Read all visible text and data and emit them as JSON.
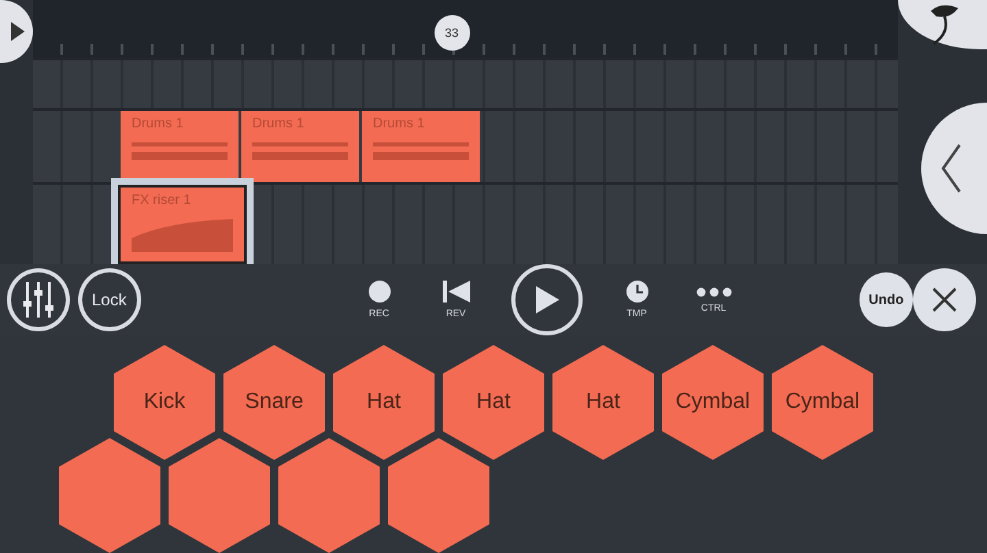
{
  "marker": "33",
  "drum_clips": [
    {
      "name": "Drums 1",
      "selected": false
    },
    {
      "name": "Drums 1",
      "selected": false
    },
    {
      "name": "Drums 1",
      "selected": false
    }
  ],
  "fx_clips": [
    {
      "name": "FX riser 1",
      "selected": true
    }
  ],
  "lock_button": "Lock",
  "transport": [
    {
      "kind": "record",
      "label": "REC"
    },
    {
      "kind": "rewind",
      "label": "REV"
    },
    {
      "kind": "play"
    },
    {
      "kind": "tempo",
      "label": "TMP"
    },
    {
      "kind": "control",
      "label": "CTRL"
    }
  ],
  "undo_button": "Undo",
  "pads": [
    {
      "label": "Kick"
    },
    {
      "label": "Snare"
    },
    {
      "label": "Hat"
    },
    {
      "label": "Hat"
    },
    {
      "label": "Hat"
    },
    {
      "label": "Cymbal"
    },
    {
      "label": "Cymbal"
    }
  ]
}
